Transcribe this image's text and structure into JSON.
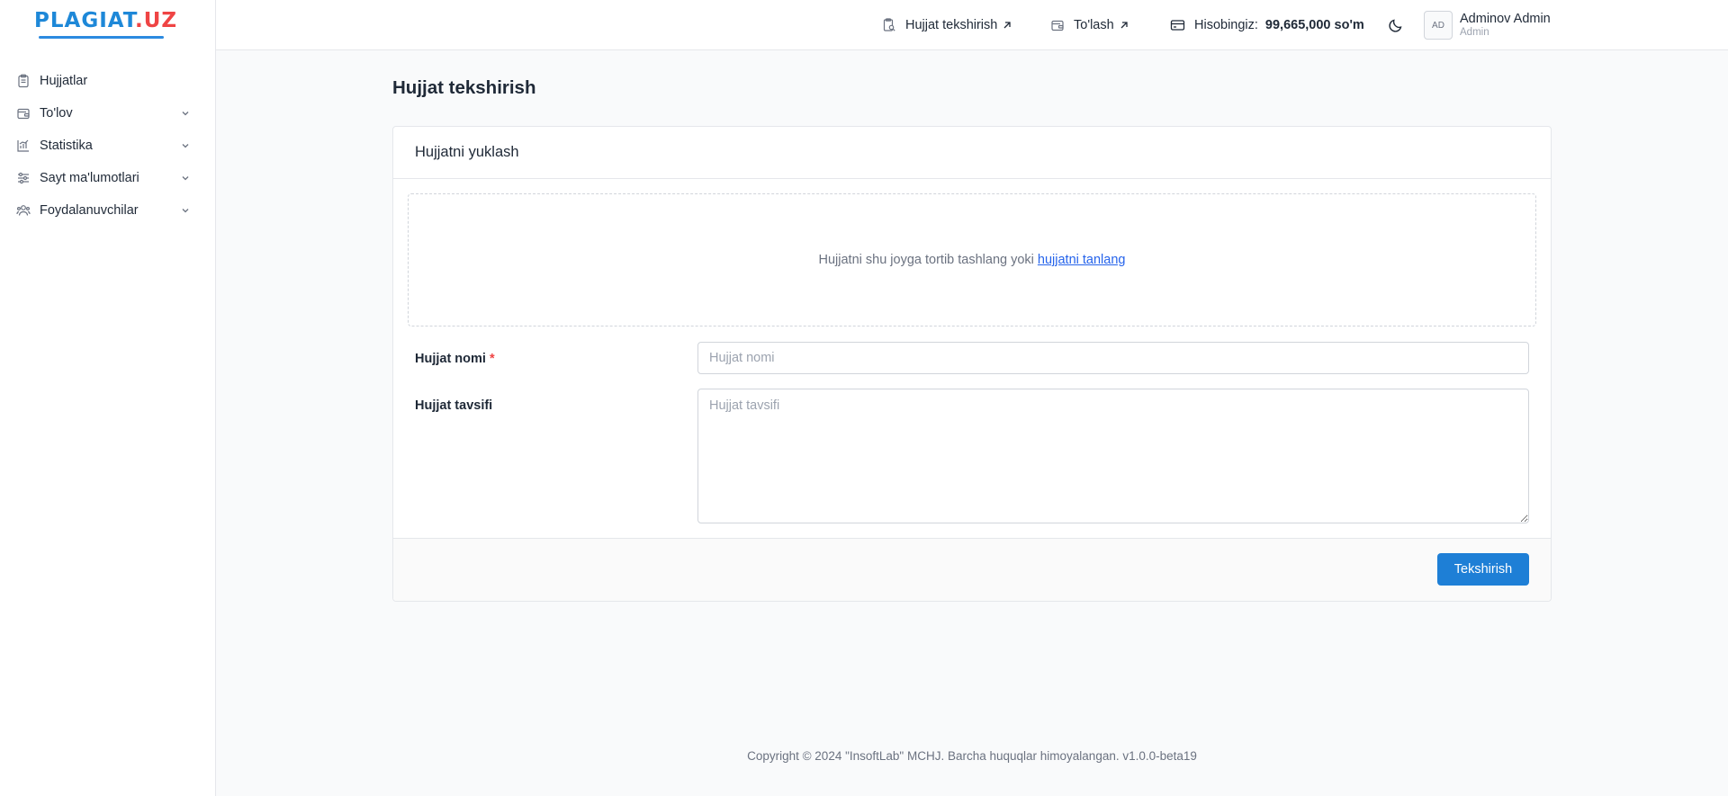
{
  "app": {
    "logo_main": "PLAGIAT",
    "logo_suffix": ".UZ",
    "brand_color": "#1e88d8",
    "accent_color": "#ef4444"
  },
  "sidebar": {
    "items": [
      {
        "label": "Hujjatlar",
        "icon": "document-clipboard-icon",
        "expandable": false
      },
      {
        "label": "To'lov",
        "icon": "wallet-icon",
        "expandable": true
      },
      {
        "label": "Statistika",
        "icon": "chart-icon",
        "expandable": true
      },
      {
        "label": "Sayt ma'lumotlari",
        "icon": "sliders-icon",
        "expandable": true
      },
      {
        "label": "Foydalanuvchilar",
        "icon": "users-icon",
        "expandable": true
      }
    ]
  },
  "header": {
    "check_label": "Hujjat tekshirish",
    "pay_label": "To'lash",
    "balance_label": "Hisobingiz:",
    "balance_value": "99,665,000 so'm",
    "theme_icon": "moon-icon",
    "user": {
      "initials": "AD",
      "name": "Adminov Admin",
      "role": "Admin"
    }
  },
  "main": {
    "page_title": "Hujjat tekshirish",
    "card_title": "Hujjatni yuklash",
    "dropzone_text": "Hujjatni shu joyga tortib tashlang yoki",
    "dropzone_link": "hujjatni tanlang",
    "name_label": "Hujjat nomi",
    "name_required_mark": "*",
    "name_placeholder": "Hujjat nomi",
    "name_value": "",
    "desc_label": "Hujjat tavsifi",
    "desc_placeholder": "Hujjat tavsifi",
    "desc_value": "",
    "submit_label": "Tekshirish"
  },
  "footer": {
    "copyright": "Copyright © 2024 \"InsoftLab\" MCHJ. Barcha huquqlar himoyalangan. v1.0.0-beta19"
  }
}
